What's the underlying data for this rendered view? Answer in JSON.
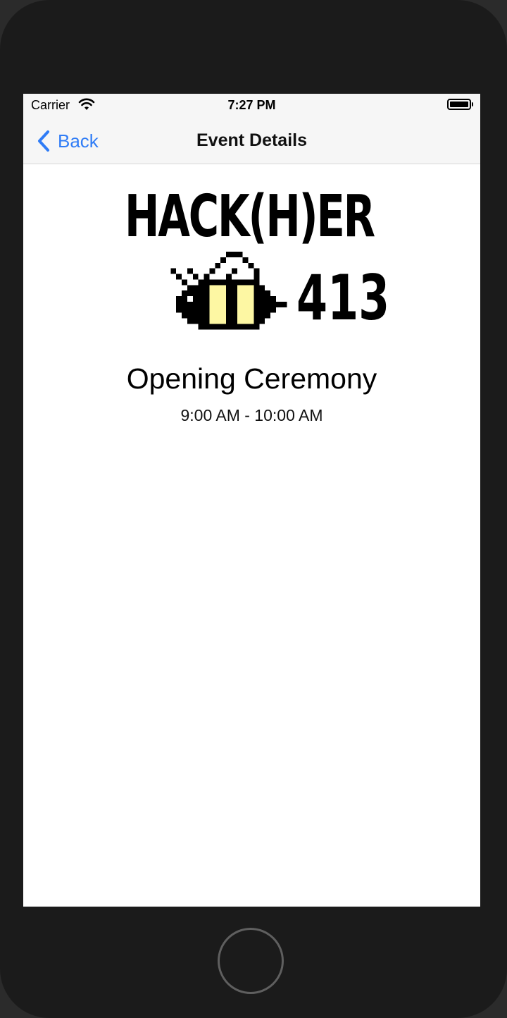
{
  "status_bar": {
    "carrier": "Carrier",
    "time": "7:27 PM",
    "wifi_icon": "wifi-icon",
    "battery_icon": "battery-icon"
  },
  "nav": {
    "back_label": "Back",
    "back_icon": "chevron-left-icon",
    "title": "Event Details"
  },
  "logo": {
    "line1": "HACK(H)ER",
    "line2": "413",
    "mascot_icon": "bee-icon",
    "colors": {
      "ink": "#000000",
      "stripe": "#fdf7a3"
    }
  },
  "event": {
    "name": "Opening Ceremony",
    "time_range": "9:00 AM - 10:00 AM"
  },
  "colors": {
    "accent": "#2f7cf6",
    "bar_background": "#f6f6f6",
    "device_frame": "#1b1b1b"
  }
}
